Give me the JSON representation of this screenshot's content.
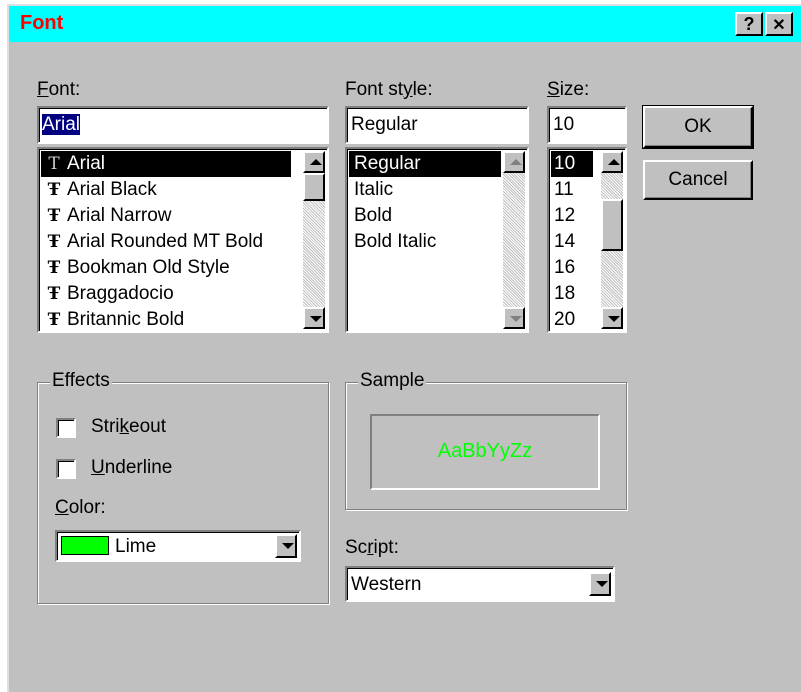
{
  "window": {
    "title": "Font",
    "help_button": "?",
    "close_button": "✕"
  },
  "font": {
    "label_u": "F",
    "label_rest": "ont:",
    "value": "Arial",
    "items": [
      {
        "name": "Arial",
        "icon": "T"
      },
      {
        "name": "Arial Black",
        "icon": "Ŧ"
      },
      {
        "name": "Arial Narrow",
        "icon": "Ŧ"
      },
      {
        "name": "Arial Rounded MT Bold",
        "icon": "Ŧ"
      },
      {
        "name": "Bookman Old Style",
        "icon": "Ŧ"
      },
      {
        "name": "Braggadocio",
        "icon": "Ŧ"
      },
      {
        "name": "Britannic Bold",
        "icon": "Ŧ"
      }
    ]
  },
  "font_style": {
    "label_pre": "Font st",
    "label_u": "y",
    "label_post": "le:",
    "value": "Regular",
    "items": [
      "Regular",
      "Italic",
      "Bold",
      "Bold Italic"
    ]
  },
  "size": {
    "label_u": "S",
    "label_rest": "ize:",
    "value": "10",
    "items": [
      "10",
      "11",
      "12",
      "14",
      "16",
      "18",
      "20"
    ]
  },
  "buttons": {
    "ok": "OK",
    "cancel": "Cancel"
  },
  "effects": {
    "title": "Effects",
    "strikeout_pre": "Stri",
    "strikeout_u": "k",
    "strikeout_post": "eout",
    "underline_u": "U",
    "underline_rest": "nderline",
    "color_u": "C",
    "color_rest": "olor:",
    "color_value": "Lime",
    "color_hex": "#00ff00"
  },
  "sample": {
    "title": "Sample",
    "text": "AaBbYyZz",
    "color": "#00ff00"
  },
  "script": {
    "label_pre": "Sc",
    "label_u": "r",
    "label_post": "ipt:",
    "value": "Western"
  }
}
